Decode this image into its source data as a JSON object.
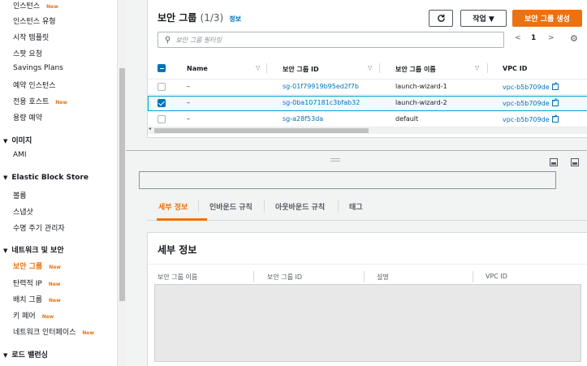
{
  "sidebar": {
    "items": [
      {
        "label": "인스턴스",
        "new": "New"
      },
      {
        "label": "인스턴스 유형"
      },
      {
        "label": "시작 템플릿"
      },
      {
        "label": "스팟 요청"
      },
      {
        "label": "Savings Plans"
      },
      {
        "label": "예약 인스턴스"
      },
      {
        "label": "전용 호스트",
        "new": "New"
      },
      {
        "label": "용량 예약"
      }
    ],
    "sections": [
      {
        "label": "이미지",
        "items": [
          {
            "label": "AMI"
          }
        ]
      },
      {
        "label": "Elastic Block Store",
        "items": [
          {
            "label": "볼륨"
          },
          {
            "label": "스냅샷"
          },
          {
            "label": "수명 주기 관리자"
          }
        ]
      },
      {
        "label": "네트워크 및 보안",
        "items": [
          {
            "label": "보안 그룹",
            "new": "New"
          },
          {
            "label": "탄력적 IP",
            "new": "New"
          },
          {
            "label": "배치 그룹",
            "new": "New"
          },
          {
            "label": "키 페어",
            "new": "New"
          },
          {
            "label": "네트워크 인터페이스",
            "new": "New"
          }
        ]
      },
      {
        "label": "로드 밸런싱",
        "items": []
      }
    ]
  },
  "table_panel": {
    "title": "보안 그룹",
    "count": "(1/3)",
    "info": "정보",
    "refresh_icon": "refresh-icon",
    "actions_label": "작업 ▼",
    "create_label": "보안 그룹 생성",
    "search_placeholder": "보안 그룹 필터링",
    "page": "1",
    "columns": [
      "Name",
      "보안 그룹 ID",
      "보안 그룹 이름",
      "VPC ID"
    ],
    "rows": [
      {
        "name": "–",
        "sg_id": "sg-01f79919b95ed2f7b",
        "sg_name": "launch-wizard-1",
        "vpc": "vpc-b5b709de",
        "selected": false
      },
      {
        "name": "–",
        "sg_id": "sg-0ba107181c3bfab32",
        "sg_name": "launch-wizard-2",
        "vpc": "vpc-b5b709de",
        "selected": true
      },
      {
        "name": "–",
        "sg_id": "sg-a28f53da",
        "sg_name": "default",
        "vpc": "vpc-b5b709de",
        "selected": false
      }
    ]
  },
  "tabs": [
    "세부 정보",
    "인바운드 규칙",
    "아웃바운드 규칙",
    "태그"
  ],
  "detail": {
    "title": "세부 정보",
    "labels": [
      "보안 그룹 이름",
      "보안 그룹 ID",
      "설명",
      "VPC ID"
    ]
  },
  "colors": {
    "accent": "#ec7211",
    "link": "#0073bb"
  }
}
